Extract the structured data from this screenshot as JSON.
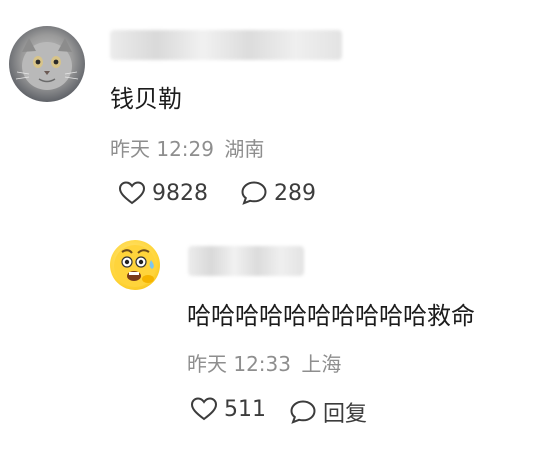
{
  "comment": {
    "text": "钱贝勒",
    "time": "昨天 12:29",
    "location": "湖南",
    "likes": "9828",
    "replies": "289"
  },
  "reply": {
    "text": "哈哈哈哈哈哈哈哈哈哈救命",
    "time": "昨天 12:33",
    "location": "上海",
    "likes": "511",
    "reply_label": "回复"
  },
  "icons": {
    "avatar_cat": "avatar-cat-icon",
    "avatar_emoji": "avatar-emoji-icon",
    "like": "heart-outline-icon",
    "comment": "speech-bubble-icon"
  }
}
